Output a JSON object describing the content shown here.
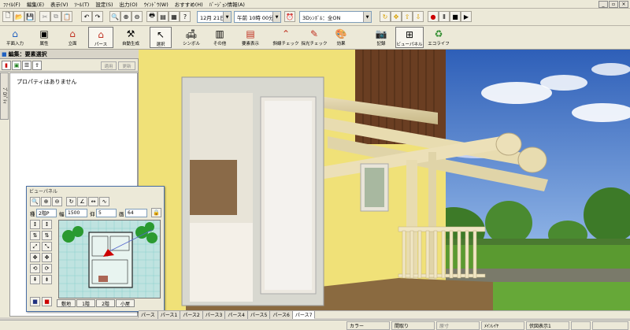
{
  "menu": [
    "ﾌｧｲﾙ(F)",
    "編集(E)",
    "表示(V)",
    "ﾂｰﾙ(T)",
    "設定(S)",
    "出力(O)",
    "ｳｲﾝﾄﾞｳ(W)",
    "おすすめ(H)",
    "ﾊﾞｰｼﾞｮﾝ情報(A)"
  ],
  "toolbar": {
    "date": "12月 21日",
    "time": "午前 10時 00分",
    "symbol_mode": "3Dｼﾝﾎﾞﾙ：全ON"
  },
  "big_buttons": [
    "平面入力",
    "属性",
    "立面",
    "パース",
    "自動生成",
    "選択",
    "シンボル",
    "その他",
    "要素表示",
    "斜線チェック",
    "採光チェック",
    "効果",
    "記録",
    "ビューパネル",
    "エコライフ"
  ],
  "left_panel": {
    "title": "編集：要素選択",
    "btn_apply": "適用",
    "btn_change": "更新",
    "vertical_tab": "ﾌﾟﾛﾊﾟﾃｨ",
    "no_property": "プロパティはありません"
  },
  "view_panel": {
    "title": "ビューパネル",
    "kind_label": "種",
    "kind_value": "2階P",
    "width_label": "幅",
    "width_value": "1500",
    "count_label": "仰",
    "count_value": "5",
    "pic_label": "画",
    "pic_value": "64",
    "floors": [
      "敷地",
      "1階",
      "2階",
      "小屋"
    ]
  },
  "view_tabs": [
    "パース",
    "パース1",
    "パース2",
    "パース3",
    "パース4",
    "パース5",
    "パース6",
    "パース7"
  ],
  "status": {
    "color": "カラー",
    "room": "間取り",
    "orig": "原寸",
    "layer": "ﾒｲﾝﾚｲﾔ",
    "display": "伏図表示1"
  },
  "colors": {
    "sky": "#3d72c4",
    "wall": "#f0e178",
    "wood": "#e8dcb0",
    "grass": "#5a9a30",
    "accent_red": "#cc0000"
  }
}
